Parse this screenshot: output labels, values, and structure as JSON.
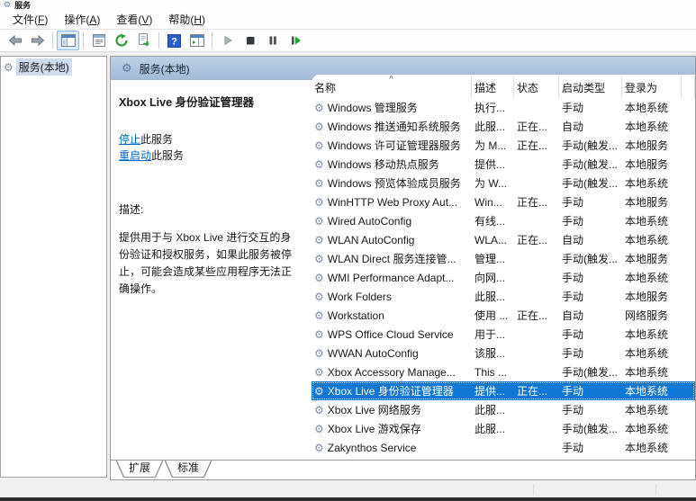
{
  "window": {
    "title": "服务"
  },
  "menu": {
    "items": [
      {
        "pre": "文件(",
        "key": "F",
        "post": ")"
      },
      {
        "pre": "操作(",
        "key": "A",
        "post": ")"
      },
      {
        "pre": "查看(",
        "key": "V",
        "post": ")"
      },
      {
        "pre": "帮助(",
        "key": "H",
        "post": ")"
      }
    ]
  },
  "toolbar": {
    "buttons": [
      "back",
      "forward",
      "show-console-tree",
      "properties",
      "refresh",
      "export-list",
      "help",
      "show-action-pane",
      "start-service",
      "stop-service",
      "pause-service",
      "restart-service"
    ]
  },
  "icons": {
    "service_gear": "⚙",
    "sort_ascending": "^"
  },
  "tree": {
    "root_label": "服务(本地)"
  },
  "main": {
    "header_label": "服务(本地)",
    "detail": {
      "service_title": "Xbox Live 身份验证管理器",
      "stop_link": "停止",
      "stop_suffix": "此服务",
      "restart_link": "重启动",
      "restart_suffix": "此服务",
      "description_label": "描述:",
      "description": "提供用于与 Xbox Live 进行交互的身份验证和授权服务，如果此服务被停止，可能会造成某些应用程序无法正确操作。"
    },
    "list": {
      "columns": [
        {
          "label": "名称"
        },
        {
          "label": "描述"
        },
        {
          "label": "状态"
        },
        {
          "label": "启动类型"
        },
        {
          "label": "登录为"
        }
      ],
      "selected_index": 15,
      "rows": [
        {
          "name": "Windows 管理服务",
          "desc": "执行...",
          "status": "",
          "startup": "手动",
          "logon": "本地系统"
        },
        {
          "name": "Windows 推送通知系统服务",
          "desc": "此服...",
          "status": "正在...",
          "startup": "自动",
          "logon": "本地系统"
        },
        {
          "name": "Windows 许可证管理器服务",
          "desc": "为 M...",
          "status": "正在...",
          "startup": "手动(触发...",
          "logon": "本地服务"
        },
        {
          "name": "Windows 移动热点服务",
          "desc": "提供...",
          "status": "",
          "startup": "手动(触发...",
          "logon": "本地服务"
        },
        {
          "name": "Windows 预览体验成员服务",
          "desc": "为 W...",
          "status": "",
          "startup": "手动(触发...",
          "logon": "本地系统"
        },
        {
          "name": "WinHTTP Web Proxy Aut...",
          "desc": "Win...",
          "status": "正在...",
          "startup": "手动",
          "logon": "本地服务"
        },
        {
          "name": "Wired AutoConfig",
          "desc": "有线...",
          "status": "",
          "startup": "手动",
          "logon": "本地系统"
        },
        {
          "name": "WLAN AutoConfig",
          "desc": "WLA...",
          "status": "正在...",
          "startup": "自动",
          "logon": "本地系统"
        },
        {
          "name": "WLAN Direct 服务连接管...",
          "desc": "管理...",
          "status": "",
          "startup": "手动(触发...",
          "logon": "本地服务"
        },
        {
          "name": "WMI Performance Adapt...",
          "desc": "向网...",
          "status": "",
          "startup": "手动",
          "logon": "本地系统"
        },
        {
          "name": "Work Folders",
          "desc": "此服...",
          "status": "",
          "startup": "手动",
          "logon": "本地服务"
        },
        {
          "name": "Workstation",
          "desc": "使用 ...",
          "status": "正在...",
          "startup": "自动",
          "logon": "网络服务"
        },
        {
          "name": "WPS Office Cloud Service",
          "desc": "用于...",
          "status": "",
          "startup": "手动",
          "logon": "本地系统"
        },
        {
          "name": "WWAN AutoConfig",
          "desc": "该服...",
          "status": "",
          "startup": "手动",
          "logon": "本地系统"
        },
        {
          "name": "Xbox Accessory Manage...",
          "desc": "This ...",
          "status": "",
          "startup": "手动(触发...",
          "logon": "本地系统"
        },
        {
          "name": "Xbox Live 身份验证管理器",
          "desc": "提供...",
          "status": "正在...",
          "startup": "手动",
          "logon": "本地系统"
        },
        {
          "name": "Xbox Live 网络服务",
          "desc": "此服...",
          "status": "",
          "startup": "手动",
          "logon": "本地系统"
        },
        {
          "name": "Xbox Live 游戏保存",
          "desc": "此服...",
          "status": "",
          "startup": "手动(触发...",
          "logon": "本地系统"
        },
        {
          "name": "Zakynthos Service",
          "desc": "",
          "status": "",
          "startup": "手动",
          "logon": "本地系统"
        }
      ]
    },
    "tabs": [
      {
        "label": "扩展"
      },
      {
        "label": "标准"
      }
    ]
  },
  "colors": {
    "selection_blue": "#0f77d4",
    "header_gradient_top": "#bdd0e6",
    "header_gradient_bottom": "#a1bad6",
    "link_blue": "#0066cc",
    "tree_selection": "#cfdcee"
  }
}
